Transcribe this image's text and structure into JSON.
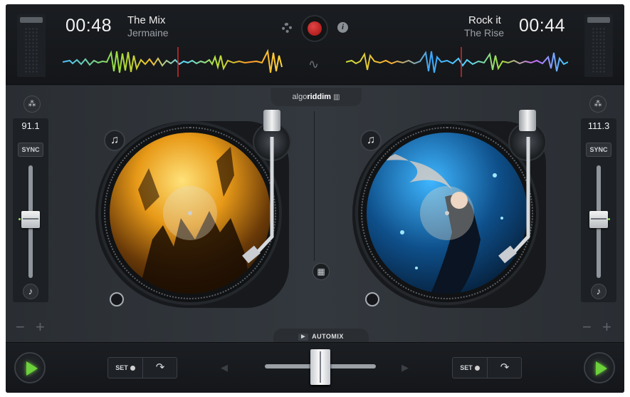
{
  "app": {
    "logo_prefix": "algo",
    "logo_bold": "riddim"
  },
  "deck_left": {
    "time": "00:48",
    "title": "The Mix",
    "artist": "Jermaine",
    "bpm": "91.1",
    "sync_label": "SYNC",
    "set_label": "SET",
    "pitch_level": 0.47
  },
  "deck_right": {
    "time": "00:44",
    "title": "Rock it",
    "artist": "The Rise",
    "bpm": "111.3",
    "sync_label": "SYNC",
    "set_label": "SET",
    "pitch_level": 0.47
  },
  "automix": {
    "label": "AUTOMIX"
  },
  "crossfader": {
    "position": 0.5
  },
  "icons": {
    "minus": "−",
    "plus": "+",
    "note": "♪",
    "add_music": "♫",
    "grid": "▦",
    "jump": "↷",
    "wave": "∿",
    "info": "i",
    "arrow_left": "◀",
    "arrow_right": "▶",
    "automix_play": "▶"
  },
  "colors": {
    "record": "#c41c1c",
    "play": "#6cd13a",
    "playhead": "#d62a2a"
  }
}
